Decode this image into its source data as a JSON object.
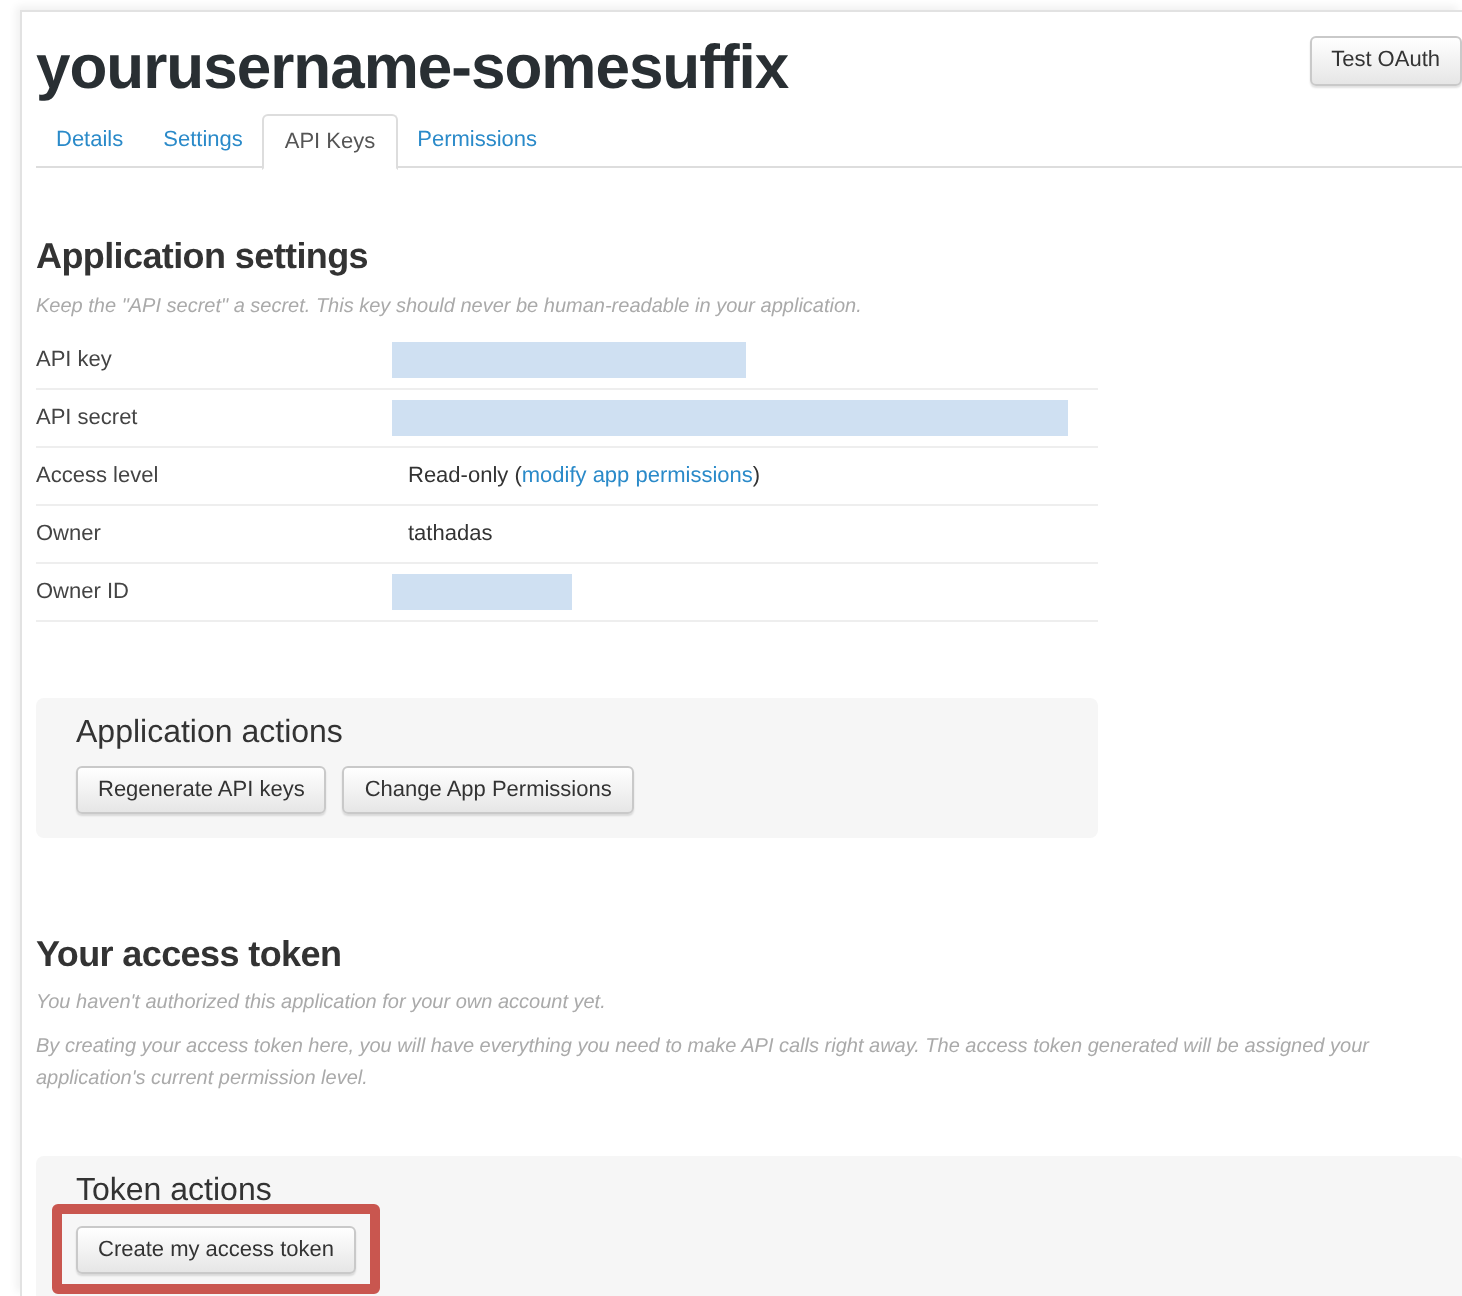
{
  "title": "yourusername-somesuffix",
  "header_button": "Test OAuth",
  "tabs": [
    {
      "label": "Details",
      "selected": false
    },
    {
      "label": "Settings",
      "selected": false
    },
    {
      "label": "API Keys",
      "selected": true
    },
    {
      "label": "Permissions",
      "selected": false
    }
  ],
  "settings": {
    "heading": "Application settings",
    "note": "Keep the \"API secret\" a secret. This key should never be human-readable in your application.",
    "rows": [
      {
        "label": "API key",
        "kind": "redacted"
      },
      {
        "label": "API secret",
        "kind": "redacted"
      },
      {
        "label": "Access level",
        "kind": "text_with_link",
        "value": "Read-only (",
        "link": "modify app permissions",
        "after": ")"
      },
      {
        "label": "Owner",
        "kind": "text",
        "value": "tathadas"
      },
      {
        "label": "Owner ID",
        "kind": "redacted"
      }
    ]
  },
  "app_actions": {
    "heading": "Application actions",
    "buttons": [
      {
        "label": "Regenerate API keys",
        "highlighted": false
      },
      {
        "label": "Change App Permissions",
        "highlighted": false
      }
    ]
  },
  "access_token": {
    "heading": "Your access token",
    "notes": [
      "You haven't authorized this application for your own account yet.",
      "By creating your access token here, you will have everything you need to make API calls right away. The access token generated will be assigned your application's current permission level."
    ]
  },
  "token_actions": {
    "heading": "Token actions",
    "buttons": [
      {
        "label": "Create my access token",
        "highlighted": true
      }
    ]
  }
}
